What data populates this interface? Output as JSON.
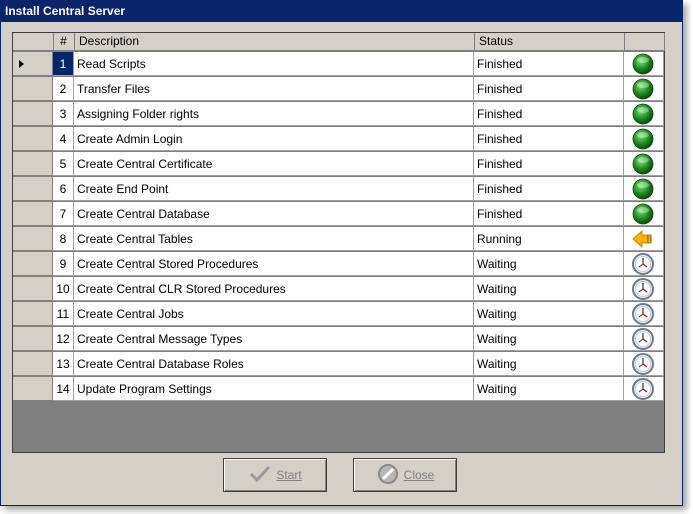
{
  "window": {
    "title": "Install Central Server"
  },
  "grid": {
    "columns": {
      "num": "#",
      "description": "Description",
      "status": "Status"
    },
    "selected_row": 0,
    "rows": [
      {
        "num": "1",
        "description": "Read Scripts",
        "status": "Finished",
        "icon": "green-check-icon"
      },
      {
        "num": "2",
        "description": "Transfer Files",
        "status": "Finished",
        "icon": "green-check-icon"
      },
      {
        "num": "3",
        "description": "Assigning Folder rights",
        "status": "Finished",
        "icon": "green-check-icon"
      },
      {
        "num": "4",
        "description": "Create Admin Login",
        "status": "Finished",
        "icon": "green-check-icon"
      },
      {
        "num": "5",
        "description": "Create Central Certificate",
        "status": "Finished",
        "icon": "green-check-icon"
      },
      {
        "num": "6",
        "description": "Create End Point",
        "status": "Finished",
        "icon": "green-check-icon"
      },
      {
        "num": "7",
        "description": "Create Central Database",
        "status": "Finished",
        "icon": "green-check-icon"
      },
      {
        "num": "8",
        "description": "Create Central Tables",
        "status": "Running",
        "icon": "running-arrow-icon"
      },
      {
        "num": "9",
        "description": "Create Central Stored Procedures",
        "status": "Waiting",
        "icon": "clock-icon"
      },
      {
        "num": "10",
        "description": "Create Central CLR Stored Procedures",
        "status": "Waiting",
        "icon": "clock-icon"
      },
      {
        "num": "11",
        "description": "Create Central Jobs",
        "status": "Waiting",
        "icon": "clock-icon"
      },
      {
        "num": "12",
        "description": "Create Central Message Types",
        "status": "Waiting",
        "icon": "clock-icon"
      },
      {
        "num": "13",
        "description": "Create Central Database Roles",
        "status": "Waiting",
        "icon": "clock-icon"
      },
      {
        "num": "14",
        "description": "Update Program Settings",
        "status": "Waiting",
        "icon": "clock-icon"
      }
    ]
  },
  "buttons": {
    "start": {
      "label": "Start",
      "icon": "check-icon",
      "enabled": false
    },
    "close": {
      "label": "Close",
      "icon": "cancel-icon",
      "enabled": false
    }
  },
  "colors": {
    "titlebar": "#0a246a",
    "finished": "#1f8a1f",
    "running": "#f4b400",
    "waiting": "#6b7a8f"
  }
}
